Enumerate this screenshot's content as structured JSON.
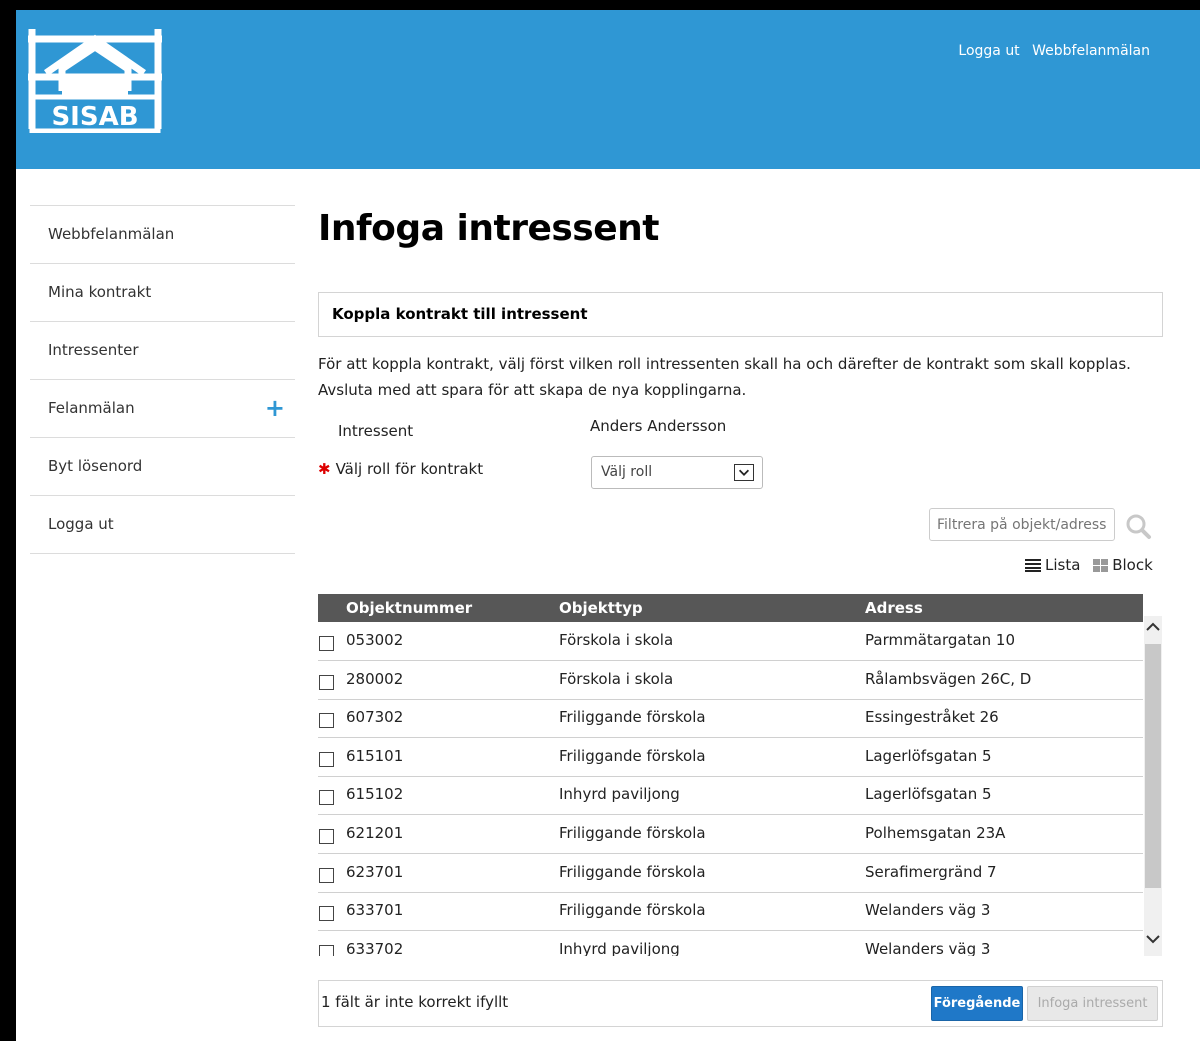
{
  "header": {
    "logo_text": "SISAB",
    "links": [
      "Logga ut",
      "Webbfelanmälan"
    ],
    "bg_color": "#2f97d4"
  },
  "sidebar": {
    "items": [
      {
        "label": "Webbfelanmälan"
      },
      {
        "label": "Mina kontrakt"
      },
      {
        "label": "Intressenter"
      },
      {
        "label": "Felanmälan",
        "icon": "plus-icon"
      },
      {
        "label": "Byt lösenord"
      },
      {
        "label": "Logga ut"
      }
    ]
  },
  "main": {
    "title": "Infoga intressent",
    "section_title": "Koppla kontrakt till intressent",
    "intro": "För att koppla kontrakt, välj först vilken roll intressenten skall ha och därefter de kontrakt som skall kopplas. Avsluta med att spara för att skapa de nya kopplingarna.",
    "form": {
      "intressent_label": "Intressent",
      "intressent_value": "Anders Andersson",
      "roll_label": "Välj roll för kontrakt",
      "roll_value": "Välj roll"
    },
    "filter_placeholder": "Filtrera på objekt/adress",
    "view": {
      "list_label": "Lista",
      "block_label": "Block"
    },
    "table": {
      "headers": [
        "Objektnummer",
        "Objekttyp",
        "Adress"
      ],
      "rows": [
        {
          "nr": "053002",
          "typ": "Förskola i skola",
          "adress": "Parmmätargatan 10"
        },
        {
          "nr": "280002",
          "typ": "Förskola i skola",
          "adress": "Rålambsvägen 26C, D"
        },
        {
          "nr": "607302",
          "typ": "Friliggande förskola",
          "adress": "Essingestråket 26"
        },
        {
          "nr": "615101",
          "typ": "Friliggande förskola",
          "adress": "Lagerlöfsgatan 5"
        },
        {
          "nr": "615102",
          "typ": "Inhyrd paviljong",
          "adress": "Lagerlöfsgatan 5"
        },
        {
          "nr": "621201",
          "typ": "Friliggande förskola",
          "adress": "Polhemsgatan 23A"
        },
        {
          "nr": "623701",
          "typ": "Friliggande förskola",
          "adress": "Serafimergränd 7"
        },
        {
          "nr": "633701",
          "typ": "Friliggande förskola",
          "adress": "Welanders väg 3"
        },
        {
          "nr": "633702",
          "typ": "Inhyrd paviljong",
          "adress": "Welanders väg 3"
        }
      ]
    },
    "footer": {
      "message": "1 fält är inte korrekt ifyllt",
      "prev_label": "Föregående",
      "insert_label": "Infoga intressent"
    }
  }
}
